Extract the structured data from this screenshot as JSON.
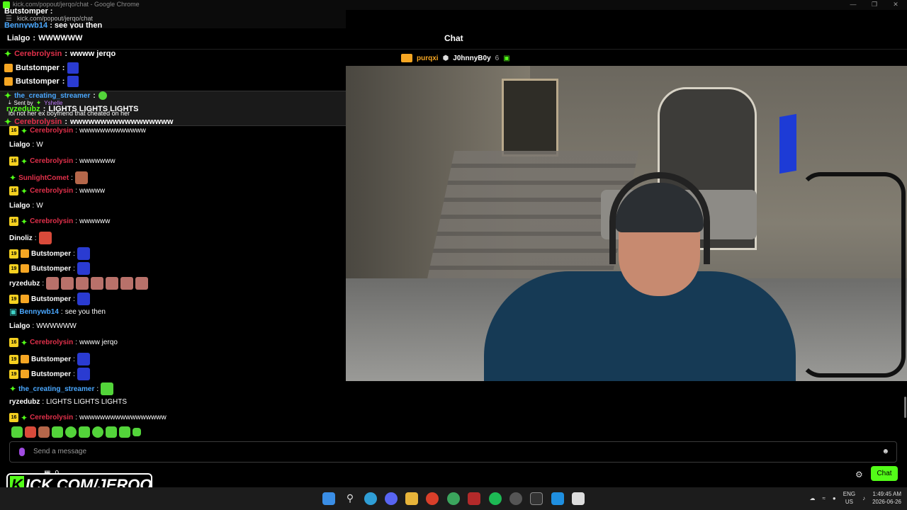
{
  "window": {
    "title": "kick.com/popout/jerqo/chat - Google Chrome",
    "url": "kick.com/popout/jerqo/chat"
  },
  "header": {
    "title": "Chat"
  },
  "ghost": [
    {
      "user": "Butstomper",
      "sep": " :",
      "text": ""
    },
    {
      "user": "Bennywb14",
      "sep": " :",
      "text": "see you then"
    }
  ],
  "pinned": [
    {
      "user": "Lialgo",
      "text": "WWWWWW"
    },
    {
      "user": "Cerebrolysin",
      "text": "wwww jerqo"
    },
    {
      "user": "Butstomper",
      "text": ""
    },
    {
      "user": "Butstomper",
      "text": ""
    }
  ],
  "reply": {
    "user": "the_creating_streamer",
    "sent_by_label": "Sent by",
    "sent_by_user": "Yshelle",
    "quote_user": "ryzedubz",
    "quote_text": "LIGHTS LIGHTS LIGHTS",
    "under_text": "lol not her ex boyfriend that cheated on her",
    "after_user": "Cerebrolysin",
    "after_text": "wwwwwwwwwwwwwwwww"
  },
  "top_chatters": [
    {
      "name": "purqxi",
      "color": "#f5a623"
    },
    {
      "name": "J0hnnyB0y",
      "count": "6",
      "color": "#ffffff"
    }
  ],
  "messages": [
    {
      "badge": "16",
      "star": true,
      "user": "Cerebrolysin",
      "color": "#e0304a",
      "text": "wwwwwwwwwwwww"
    },
    {
      "badge": "",
      "star": false,
      "user": "Lialgo",
      "color": "#ffffff",
      "text": "W"
    },
    {
      "badge": "16",
      "star": true,
      "user": "Cerebrolysin",
      "color": "#e0304a",
      "text": "wwwwwww"
    },
    {
      "badge": "",
      "star": true,
      "user": "SunlightComet",
      "color": "#e0304a",
      "text": ""
    },
    {
      "badge": "16",
      "star": true,
      "user": "Cerebrolysin",
      "color": "#e0304a",
      "text": "wwwww"
    },
    {
      "badge": "",
      "star": false,
      "user": "Lialgo",
      "color": "#ffffff",
      "text": "W"
    },
    {
      "badge": "16",
      "star": true,
      "user": "Cerebrolysin",
      "color": "#e0304a",
      "text": "wwwwww"
    },
    {
      "badge": "",
      "star": false,
      "user": "Dinoliz",
      "color": "#ffffff",
      "text": ""
    },
    {
      "badge": "19",
      "crown": true,
      "user": "Butstomper",
      "color": "#ffffff",
      "text": ""
    },
    {
      "badge": "19",
      "crown": true,
      "user": "Butstomper",
      "color": "#ffffff",
      "text": ""
    },
    {
      "badge": "",
      "star": false,
      "user": "ryzedubz",
      "color": "#ffffff",
      "text": ""
    },
    {
      "badge": "19",
      "crown": true,
      "user": "Butstomper",
      "color": "#ffffff",
      "text": ""
    },
    {
      "badge": "",
      "gift": true,
      "user": "Bennywb14",
      "color": "#4aa8ff",
      "text": "see you then"
    },
    {
      "badge": "",
      "star": false,
      "user": "Lialgo",
      "color": "#ffffff",
      "text": "WWWWWW"
    },
    {
      "badge": "16",
      "star": true,
      "user": "Cerebrolysin",
      "color": "#e0304a",
      "text": "wwww jerqo"
    },
    {
      "badge": "19",
      "crown": true,
      "user": "Butstomper",
      "color": "#ffffff",
      "text": ""
    },
    {
      "badge": "19",
      "crown": true,
      "user": "Butstomper",
      "color": "#ffffff",
      "text": ""
    },
    {
      "badge": "",
      "star": true,
      "user": "the_creating_streamer",
      "color": "#4aa8ff",
      "text": ""
    },
    {
      "badge": "",
      "star": false,
      "user": "ryzedubz",
      "color": "#ffffff",
      "text": "LIGHTS LIGHTS LIGHTS"
    },
    {
      "badge": "16",
      "star": true,
      "user": "Cerebrolysin",
      "color": "#e0304a",
      "text": "wwwwwwwwwwwwwwwww"
    }
  ],
  "input": {
    "placeholder": "Send a message"
  },
  "chat_button": "Chat",
  "brand": {
    "k": "K",
    "text": "ICK.COM/JERQO"
  },
  "viewers": "0",
  "taskbar": {
    "lang1": "ENG",
    "lang2": "US",
    "time": "1:49:45 AM",
    "date": "2026-06-26"
  },
  "colors": {
    "accent": "#53fc18",
    "sub_badge": "#f5d020",
    "crown": "#f5a623"
  }
}
